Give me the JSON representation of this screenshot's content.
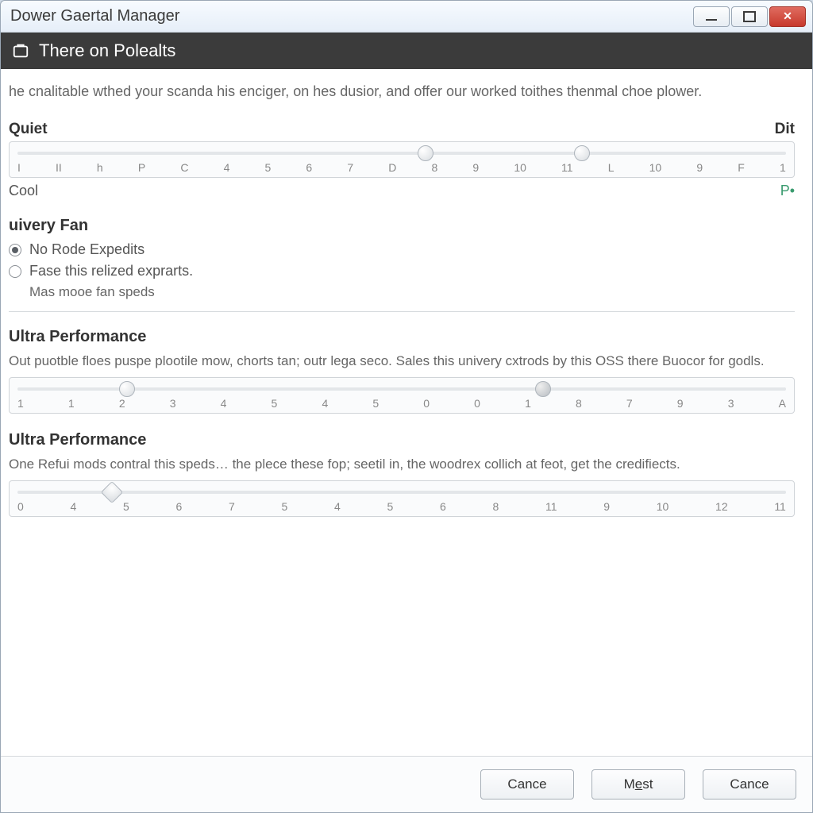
{
  "window": {
    "title": "Dower Gaertal Manager"
  },
  "header": {
    "title": "There on Polealts"
  },
  "description": "he cnalitable wthed your scanda his enciger, on hes dusior, and offer our worked toithes thenmal choe plower.",
  "slider1": {
    "left_label": "Quiet",
    "right_label": "Dit",
    "ticks": [
      "I",
      "II",
      "h",
      "P",
      "C",
      "4",
      "5",
      "6",
      "7",
      "D",
      "8",
      "9",
      "10",
      "11",
      "L",
      "10",
      "9",
      "F",
      "1"
    ],
    "bottom_left": "Cool",
    "bottom_right": "P•"
  },
  "fan": {
    "title": "uivery Fan",
    "option1": "No Rode Expedits",
    "option2": "Fase this relized exprarts.",
    "sub": "Mas mooe fan speds"
  },
  "perf1": {
    "title": "Ultra Performance",
    "desc": "Out puotble floes puspe plootile mow, chorts tan; outr lega seco. Sales this univery cxtrods by this OSS there Buocor for godls.",
    "ticks": [
      "1",
      "1",
      "2",
      "3",
      "4",
      "5",
      "4",
      "5",
      "0",
      "0",
      "1",
      "8",
      "7",
      "9",
      "3",
      "A"
    ]
  },
  "perf2": {
    "title": "Ultra Performance",
    "desc": "One Refui mods contral this speds… the plece these fop; seetil in, the woodrex collich at feot, get the credifiects.",
    "ticks": [
      "0",
      "4",
      "5",
      "6",
      "7",
      "5",
      "4",
      "5",
      "6",
      "8",
      "11",
      "9",
      "10",
      "12",
      "11"
    ]
  },
  "footer": {
    "btn1": "Cance",
    "btn2_pre": "M",
    "btn2_ul": "e",
    "btn2_post": "st",
    "btn3": "Cance"
  }
}
